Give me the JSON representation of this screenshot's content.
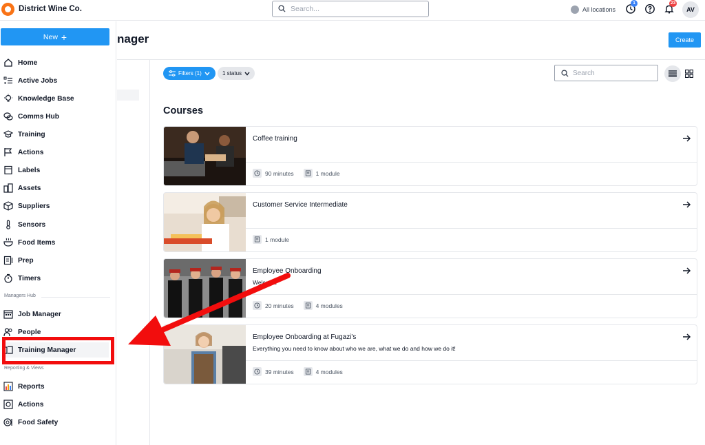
{
  "app": {
    "brand": "District Wine Co."
  },
  "topbar": {
    "search_placeholder": "Search...",
    "location_label": "All locations",
    "tasks_badge": "1",
    "notifications_badge": "23",
    "avatar_initials": "AV"
  },
  "sidebar": {
    "new_label": "New",
    "items": [
      {
        "label": "Home",
        "icon": "home-icon"
      },
      {
        "label": "Active Jobs",
        "icon": "list-check-icon"
      },
      {
        "label": "Knowledge Base",
        "icon": "lightbulb-icon"
      },
      {
        "label": "Comms Hub",
        "icon": "chat-bubbles-icon"
      },
      {
        "label": "Training",
        "icon": "graduation-cap-icon"
      },
      {
        "label": "Actions",
        "icon": "flag-icon"
      },
      {
        "label": "Labels",
        "icon": "label-icon"
      },
      {
        "label": "Assets",
        "icon": "assets-icon"
      },
      {
        "label": "Suppliers",
        "icon": "box-icon"
      },
      {
        "label": "Sensors",
        "icon": "thermometer-icon"
      },
      {
        "label": "Food Items",
        "icon": "food-bowl-icon"
      },
      {
        "label": "Prep",
        "icon": "prep-icon"
      },
      {
        "label": "Timers",
        "icon": "timer-icon"
      }
    ],
    "managers_hub_heading": "Managers Hub",
    "managers_items": [
      {
        "label": "Job Manager",
        "icon": "calendar-icon"
      },
      {
        "label": "People",
        "icon": "people-icon"
      },
      {
        "label": "Training Manager",
        "icon": "training-manager-icon"
      }
    ],
    "reporting_heading": "Reporting & Views",
    "reporting_items": [
      {
        "label": "Reports",
        "icon": "bar-chart-icon"
      },
      {
        "label": "Actions",
        "icon": "actions-board-icon"
      },
      {
        "label": "Food Safety",
        "icon": "food-safety-icon"
      }
    ]
  },
  "page": {
    "title": "nager",
    "create_label": "Create"
  },
  "filters": {
    "filters_label": "Filters (1)",
    "status_label": "1 status",
    "search_placeholder": "Search"
  },
  "courses": {
    "heading": "Courses",
    "items": [
      {
        "title": "Coffee training",
        "description": "",
        "duration": "90 minutes",
        "modules": "1 module"
      },
      {
        "title": "Customer Service Intermediate",
        "description": "",
        "duration": "",
        "modules": "1 module"
      },
      {
        "title": "Employee Onboarding",
        "description": "Welcome",
        "duration": "20 minutes",
        "modules": "4 modules"
      },
      {
        "title": "Employee Onboarding at Fugazi's",
        "description": "Everything you need to know about who we are, what we do and how we do it!",
        "duration": "39 minutes",
        "modules": "4 modules"
      }
    ]
  },
  "colors": {
    "accent": "#2196f3",
    "annotation_red": "#f20d0d",
    "brand_orange": "#f97316"
  }
}
